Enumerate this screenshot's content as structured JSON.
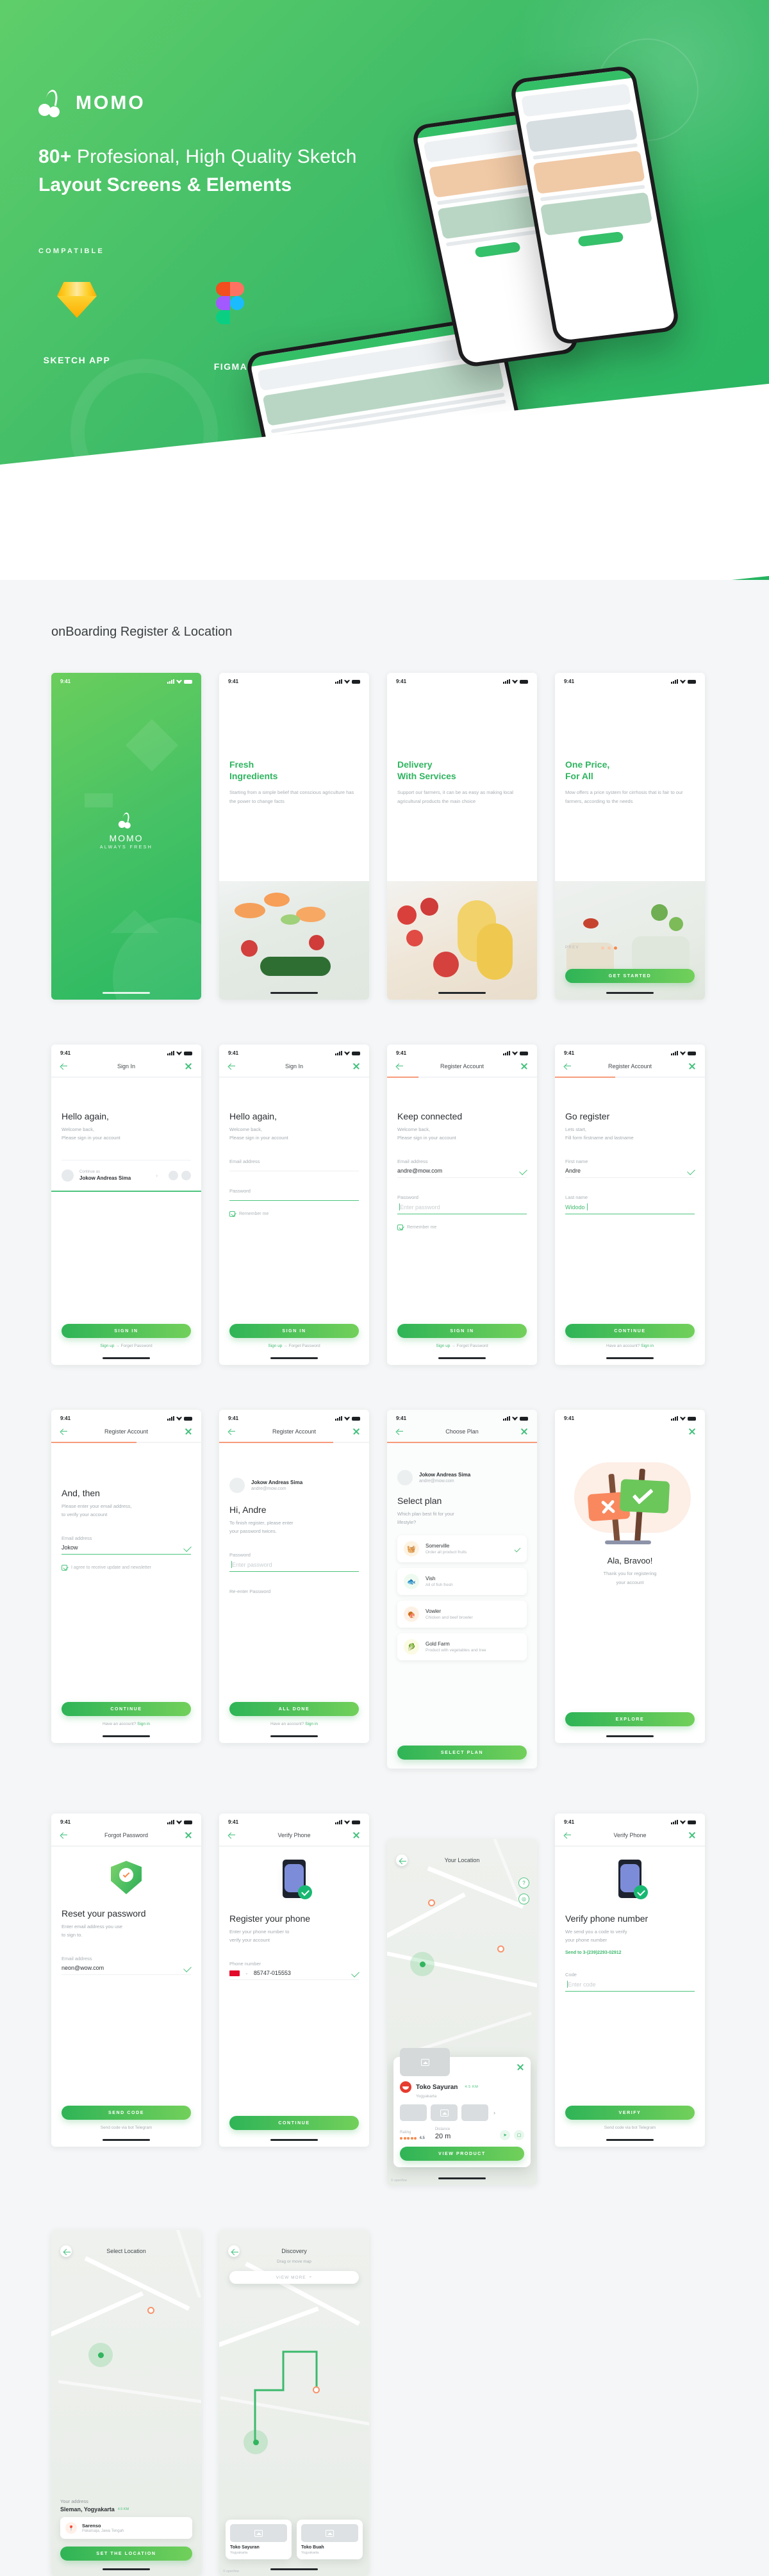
{
  "hero": {
    "brand": "MOMO",
    "headline_1_strong": "80+ ",
    "headline_1_rest": "Profesional, High Quality Sketch",
    "headline_2": "Layout Screens & Elements",
    "compatible_label": "COMPATIBLE",
    "compatible": [
      {
        "label": "SKETCH APP",
        "icon": "sketch-icon"
      },
      {
        "label": "FIGMA",
        "icon": "figma-icon"
      }
    ]
  },
  "section": {
    "title": "onBoarding  Register & Location"
  },
  "status_bar": {
    "time": "9:41"
  },
  "splash": {
    "name": "MOMO",
    "tagline": "ALWAYS FRESH"
  },
  "onboarding": [
    {
      "title_l1": "Fresh",
      "title_l2": "Ingredients",
      "sub": "Starting from a simple belief that conscious agriculture has the power to change facts"
    },
    {
      "title_l1": "Delivery",
      "title_l2": "With Services",
      "sub": "Support our farmers, it can be as easy as making local agricultural products the main choice"
    },
    {
      "title_l1": "One Price,",
      "title_l2": "For All",
      "sub": "Mow offers a price system for cirrhosis that is fair to our farmers, according to the needs",
      "prev": "PREV",
      "cta": "GET STARTED"
    }
  ],
  "signin_1": {
    "nav_title": "Sign In",
    "h1": "Hello again,",
    "sub_l1": "Welcome back,",
    "sub_l2": "Please sign in your account",
    "continue_small": "Continue as",
    "continue_name": "Jokow Andreas Sima",
    "cta": "SIGN IN",
    "under_1": "Sign up",
    "under_sep": "→",
    "under_2": "Forget Password"
  },
  "signin_2": {
    "nav_title": "Sign In",
    "h1": "Hello again,",
    "sub_l1": "Welcome back,",
    "sub_l2": "Please sign in your account",
    "email_label": "Email address",
    "email_value": "",
    "password_label": "Password",
    "password_value": "",
    "remember": "Remember me",
    "cta": "SIGN IN",
    "under_1": "Sign up",
    "under_sep": "→",
    "under_2": "Forget Password"
  },
  "register_keep": {
    "nav_title": "Register Account",
    "h1": "Keep connected",
    "sub_l1": "Welcome back,",
    "sub_l2": "Please sign in your account",
    "email_label": "Email address",
    "email_value": "andre@mow.com",
    "password_label": "Password",
    "password_placeholder": "Enter password",
    "remember": "Remember me",
    "cta": "SIGN IN",
    "under_1": "Sign up",
    "under_sep": "→",
    "under_2": "Forget Password"
  },
  "register_go": {
    "nav_title": "Register Account",
    "h1": "Go register",
    "sub_l1": "Lets start,",
    "sub_l2": "Fill form firstname and lastname",
    "first_label": "First name",
    "first_value": "Andre",
    "last_label": "Last name",
    "last_value": "Widodo",
    "cta": "CONTINUE",
    "under": "Have an account? ",
    "under_link": "Sign in"
  },
  "register_andthen": {
    "nav_title": "Register Account",
    "h1": "And, then",
    "sub_l1": "Please enter your email address,",
    "sub_l2": "to verify your account",
    "email_label": "Email address",
    "email_value": "Jokow",
    "agree": "I agree to receive update and newsletter",
    "cta": "CONTINUE",
    "under": "Have an account? ",
    "under_link": "Sign in"
  },
  "register_hi": {
    "nav_title": "Register Account",
    "user_name": "Jokow Andreas Sima",
    "user_email": "andre@mow.com",
    "h1": "Hi, Andre",
    "sub_l1": "To finish register, please enter",
    "sub_l2": "your password twices.",
    "password_label": "Password",
    "password_placeholder": "Enter password",
    "repassword_label": "Re-enter Password",
    "cta": "ALL DONE",
    "under": "Have an account? ",
    "under_link": "Sign in"
  },
  "choose_plan": {
    "nav_title": "Choose Plan",
    "user_name": "Jokow Andreas Sima",
    "user_email": "andre@mow.com",
    "h1": "Select plan",
    "sub_l1": "Which plan best fit for your",
    "sub_l2": "lifestyle?",
    "plans": [
      {
        "name": "Somerville",
        "desc": "Order all product fruits",
        "icon": "fruit-basket-icon",
        "selected": true
      },
      {
        "name": "Vish",
        "desc": "All of fish fresh",
        "icon": "fish-icon",
        "selected": false
      },
      {
        "name": "Vowler",
        "desc": "Chicken and beef browler",
        "icon": "meat-icon",
        "selected": false
      },
      {
        "name": "Gold Farm",
        "desc": "Product with vegetables and tree",
        "icon": "leaf-icon",
        "selected": false
      }
    ],
    "cta": "SELECT PLAN"
  },
  "bravo": {
    "h1": "Ala, Bravoo!",
    "sub_l1": "Thank you for registering",
    "sub_l2": "your account",
    "cta": "EXPLORE"
  },
  "forgot": {
    "nav_title": "Forgot Password",
    "h1": "Reset your password",
    "sub_l1": "Enter email address you use",
    "sub_l2": "to sign to.",
    "email_label": "Email address",
    "email_value": "neon@wow.com",
    "cta": "SEND CODE",
    "under": "Send code via bot Telegram"
  },
  "verify_register": {
    "nav_title": "Verify Phone",
    "h1": "Register your phone",
    "sub_l1": "Enter your phone number to",
    "sub_l2": "verify your account",
    "phone_label": "Phone number",
    "country": "Indonesia",
    "phone_value": "85747-015553",
    "cta": "CONTINUE"
  },
  "your_location": {
    "nav_title": "Your Location",
    "shop_name": "Toko Sayuran",
    "shop_distance_badge": "4.5 KM",
    "shop_city": "Yogyakarta",
    "rating_label": "Rating",
    "rating_value": "4.5",
    "distance_label": "Distance",
    "distance_value": "20 m",
    "cta": "VIEW PRODUCT",
    "attribution": "© openflow"
  },
  "verify_code": {
    "nav_title": "Verify Phone",
    "h1": "Verify phone number",
    "sub_l1": "We send you a code to verify",
    "sub_l2": "your phone number",
    "send_to": "Send to 3-(239)2293-02912",
    "code_label": "Code",
    "code_placeholder": "Enter code",
    "cta": "VERIFY",
    "under": "Send code via bot Telegram"
  },
  "select_location": {
    "nav_title": "Select Location",
    "address_label": "Your address",
    "address_name": "Sleman, Yogyakarta",
    "address_badge": "4.5 KM",
    "poi_name": "Sarenso",
    "poi_desc": "Pakarsaja, Jawa Tengah",
    "cta": "SET THE LOCATION"
  },
  "discovery": {
    "nav_title": "Discovery",
    "sub": "Drag or move map",
    "search": "VIEW MORE",
    "stores": [
      {
        "name": "Toko Sayuran",
        "city": "Yogyakarta"
      },
      {
        "name": "Toko Buah",
        "city": "Yogyakarta"
      }
    ],
    "attribution": "© openflow"
  },
  "colors": {
    "brand_green": "#2fb45f",
    "accent_green": "#4cc47d",
    "orange": "#f8884c",
    "text_dark": "#2a2e31",
    "text_muted": "#a8aeb3",
    "bg": "#f4f6f7"
  }
}
